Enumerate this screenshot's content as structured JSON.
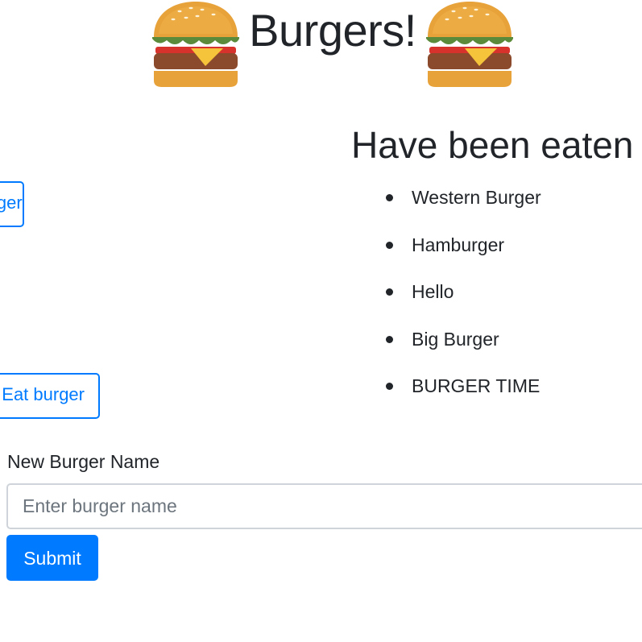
{
  "header": {
    "title": "Burgers!",
    "icon": "hamburger-icon"
  },
  "not_eaten": {
    "buttons": [
      {
        "label": "Eat burger"
      },
      {
        "label": "Eat burger"
      }
    ]
  },
  "devoured": {
    "heading": "Have been eaten",
    "items": [
      "Western Burger",
      "Hamburger",
      "Hello",
      "Big Burger",
      "BURGER TIME"
    ]
  },
  "form": {
    "label": "New Burger Name",
    "input_value": "",
    "input_placeholder": "Enter burger name",
    "submit_label": "Submit"
  },
  "colors": {
    "primary": "#007bff",
    "text": "#212529",
    "input_border": "#ced4da",
    "placeholder": "#6c757d"
  }
}
